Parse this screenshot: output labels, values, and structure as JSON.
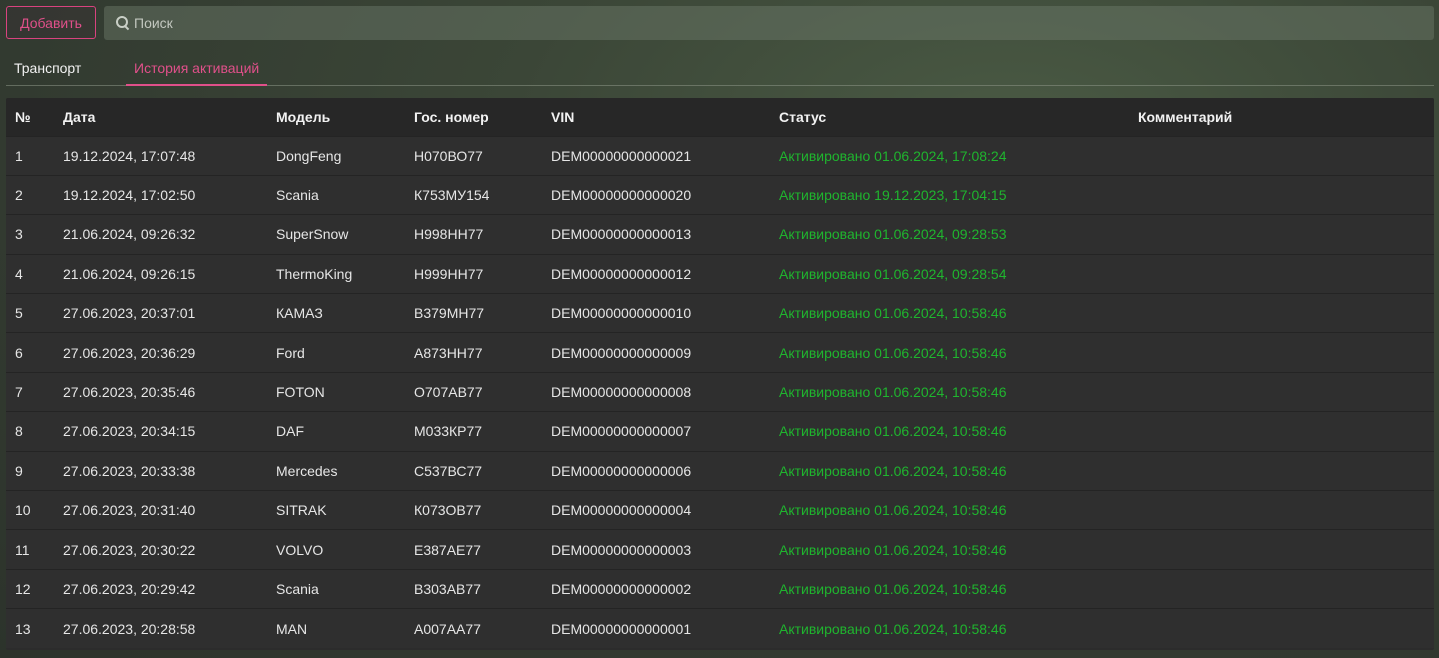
{
  "toolbar": {
    "add_label": "Добавить",
    "search_placeholder": "Поиск"
  },
  "tabs": [
    {
      "label": "Транспорт",
      "active": false
    },
    {
      "label": "История активаций",
      "active": true
    }
  ],
  "colors": {
    "accent": "#e0508a",
    "status_ok": "#1fb52e"
  },
  "table": {
    "headers": [
      "№",
      "Дата",
      "Модель",
      "Гос. номер",
      "VIN",
      "Статус",
      "Комментарий"
    ],
    "rows": [
      [
        "1",
        "19.12.2024, 17:07:48",
        "DongFeng",
        "Н070ВО77",
        "DEM00000000000021",
        "Активировано 01.06.2024, 17:08:24",
        ""
      ],
      [
        "2",
        "19.12.2024, 17:02:50",
        "Scania",
        "К753МУ154",
        "DEM00000000000020",
        "Активировано 19.12.2023, 17:04:15",
        ""
      ],
      [
        "3",
        "21.06.2024, 09:26:32",
        "SuperSnow",
        "Н998НН77",
        "DEM00000000000013",
        "Активировано 01.06.2024, 09:28:53",
        ""
      ],
      [
        "4",
        "21.06.2024, 09:26:15",
        "ThermoKing",
        "Н999НН77",
        "DEM00000000000012",
        "Активировано 01.06.2024, 09:28:54",
        ""
      ],
      [
        "5",
        "27.06.2023, 20:37:01",
        "КАМАЗ",
        "В379МН77",
        "DEM00000000000010",
        "Активировано 01.06.2024, 10:58:46",
        ""
      ],
      [
        "6",
        "27.06.2023, 20:36:29",
        "Ford",
        "А873НН77",
        "DEM00000000000009",
        "Активировано 01.06.2024, 10:58:46",
        ""
      ],
      [
        "7",
        "27.06.2023, 20:35:46",
        "FOTON",
        "О707АВ77",
        "DEM00000000000008",
        "Активировано 01.06.2024, 10:58:46",
        ""
      ],
      [
        "8",
        "27.06.2023, 20:34:15",
        "DAF",
        "М033КР77",
        "DEM00000000000007",
        "Активировано 01.06.2024, 10:58:46",
        ""
      ],
      [
        "9",
        "27.06.2023, 20:33:38",
        "Mercedes",
        "С537ВС77",
        "DEM00000000000006",
        "Активировано 01.06.2024, 10:58:46",
        ""
      ],
      [
        "10",
        "27.06.2023, 20:31:40",
        "SITRAK",
        "К073ОВ77",
        "DEM00000000000004",
        "Активировано 01.06.2024, 10:58:46",
        ""
      ],
      [
        "11",
        "27.06.2023, 20:30:22",
        "VOLVO",
        "Е387АЕ77",
        "DEM00000000000003",
        "Активировано 01.06.2024, 10:58:46",
        ""
      ],
      [
        "12",
        "27.06.2023, 20:29:42",
        "Scania",
        "В303АВ77",
        "DEM00000000000002",
        "Активировано 01.06.2024, 10:58:46",
        ""
      ],
      [
        "13",
        "27.06.2023, 20:28:58",
        "MAN",
        "А007АА77",
        "DEM00000000000001",
        "Активировано 01.06.2024, 10:58:46",
        ""
      ]
    ]
  }
}
